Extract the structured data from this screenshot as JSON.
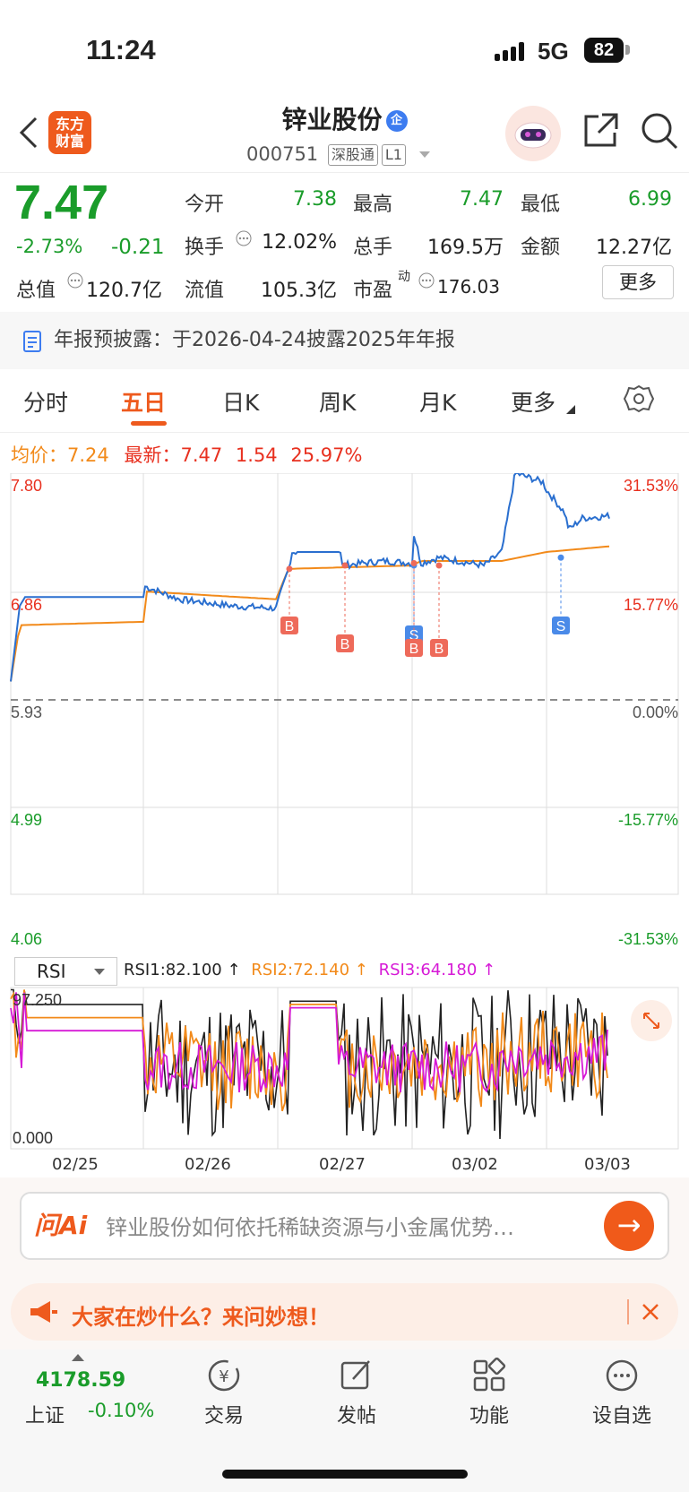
{
  "status": {
    "time": "11:24",
    "network": "5G",
    "battery": "82"
  },
  "header": {
    "logo": "东方财富",
    "stock_name": "锌业股份",
    "verified": "企",
    "code": "000751",
    "tag1": "深股通",
    "tag2": "L1"
  },
  "quote": {
    "price": "7.47",
    "pct": "-2.73%",
    "change": "-0.21",
    "open_label": "今开",
    "open": "7.38",
    "high_label": "最高",
    "high": "7.47",
    "low_label": "最低",
    "low": "6.99",
    "turnover_label": "换手",
    "turnover": "12.02%",
    "vol_label": "总手",
    "vol": "169.5万",
    "amount_label": "金额",
    "amount": "12.27亿",
    "mcap_label": "总值",
    "mcap": "120.7亿",
    "float_label": "流值",
    "float": "105.3亿",
    "pe_label": "市盈",
    "pe_sup": "动",
    "pe": "176.03",
    "more": "更多"
  },
  "notice": "年报预披露：于2026-04-24披露2025年年报",
  "tabs": [
    "分时",
    "五日",
    "日K",
    "周K",
    "月K",
    "更多"
  ],
  "active_tab": "五日",
  "avg_bar": {
    "avg_label": "均价：",
    "avg": "7.24",
    "latest_label": "最新：",
    "latest": "7.47",
    "chg": "1.54",
    "pct": "25.97%"
  },
  "chart_data": [
    {
      "type": "line",
      "y_left_ticks": [
        "7.80",
        "6.86",
        "5.93",
        "4.99",
        "4.06"
      ],
      "y_right_ticks": [
        "31.53%",
        "15.77%",
        "0.00%",
        "-15.77%",
        "-31.53%"
      ],
      "ylim": [
        4.06,
        7.8
      ],
      "x_dates": [
        "02/25",
        "02/26",
        "02/27",
        "03/02",
        "03/03"
      ],
      "series": [],
      "markers": [
        "B",
        "B",
        "S",
        "B",
        "B",
        "S"
      ]
    },
    {
      "type": "line",
      "indicator": "RSI",
      "y_ticks": [
        "97.250",
        "0.000"
      ],
      "ylim": [
        0,
        97.25
      ],
      "series": [
        {
          "name": "RSI1",
          "value": 82.1,
          "color": "#222222"
        },
        {
          "name": "RSI2",
          "value": 72.14,
          "color": "#f28a1a"
        },
        {
          "name": "RSI3",
          "value": 64.18,
          "color": "#d61ad6"
        }
      ]
    }
  ],
  "rsi": {
    "selector": "RSI",
    "rsi1": "RSI1:82.100 ↑",
    "rsi2": "RSI2:72.140 ↑",
    "rsi3": "RSI3:64.180 ↑"
  },
  "ai": {
    "logo": "问Ai",
    "prompt": "锌业股份如何依托稀缺资源与小金属优势…"
  },
  "banner": {
    "text": "大家在炒什么？来问妙想！"
  },
  "bottom": {
    "index_value": "4178.59",
    "index_name": "上证",
    "index_pct": "-0.10%",
    "items": [
      "交易",
      "发帖",
      "功能",
      "设自选"
    ]
  }
}
